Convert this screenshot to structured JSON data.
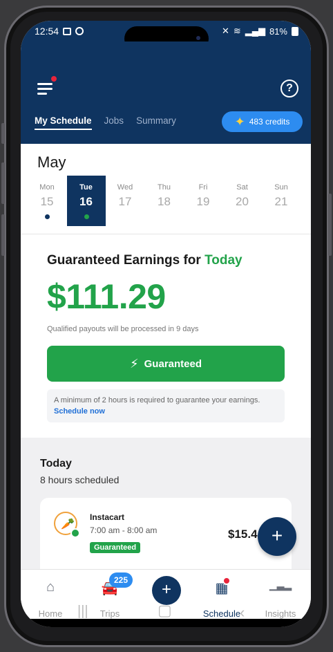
{
  "status_bar": {
    "time": "12:54",
    "battery": "81%"
  },
  "header": {
    "tabs": [
      "My Schedule",
      "Jobs",
      "Summary"
    ],
    "credits_label": "483 credits"
  },
  "calendar": {
    "month": "May",
    "days": [
      {
        "name": "Mon",
        "date": "15"
      },
      {
        "name": "Tue",
        "date": "16"
      },
      {
        "name": "Wed",
        "date": "17"
      },
      {
        "name": "Thu",
        "date": "18"
      },
      {
        "name": "Fri",
        "date": "19"
      },
      {
        "name": "Sat",
        "date": "20"
      },
      {
        "name": "Sun",
        "date": "21"
      }
    ],
    "active_index": 1
  },
  "earnings": {
    "title_prefix": "Guaranteed Earnings for",
    "title_highlight": "Today",
    "amount": "$111.29",
    "payout_note": "Qualified payouts will be processed in 9 days",
    "button_label": "Guaranteed",
    "info_text": "A minimum of 2 hours is required to guarantee your earnings.",
    "info_link": "Schedule now"
  },
  "today": {
    "heading": "Today",
    "subheading": "8 hours scheduled",
    "shift": {
      "platform": "Instacart",
      "time": "7:00 am - 8:00 am",
      "badge": "Guaranteed",
      "amount": "$15.4"
    }
  },
  "bottom_nav": {
    "items": [
      {
        "label": "Home",
        "icon": "home-icon"
      },
      {
        "label": "Trips",
        "icon": "car-icon"
      },
      {
        "label": "Schedule",
        "icon": "calendar-icon"
      },
      {
        "label": "Insights",
        "icon": "bar-chart-icon"
      }
    ],
    "trips_badge": "225",
    "active": "Schedule"
  },
  "colors": {
    "brand_navy": "#0f3460",
    "success_green": "#22a34a",
    "accent_blue": "#2d8cf0",
    "alert_red": "#e8243b"
  }
}
